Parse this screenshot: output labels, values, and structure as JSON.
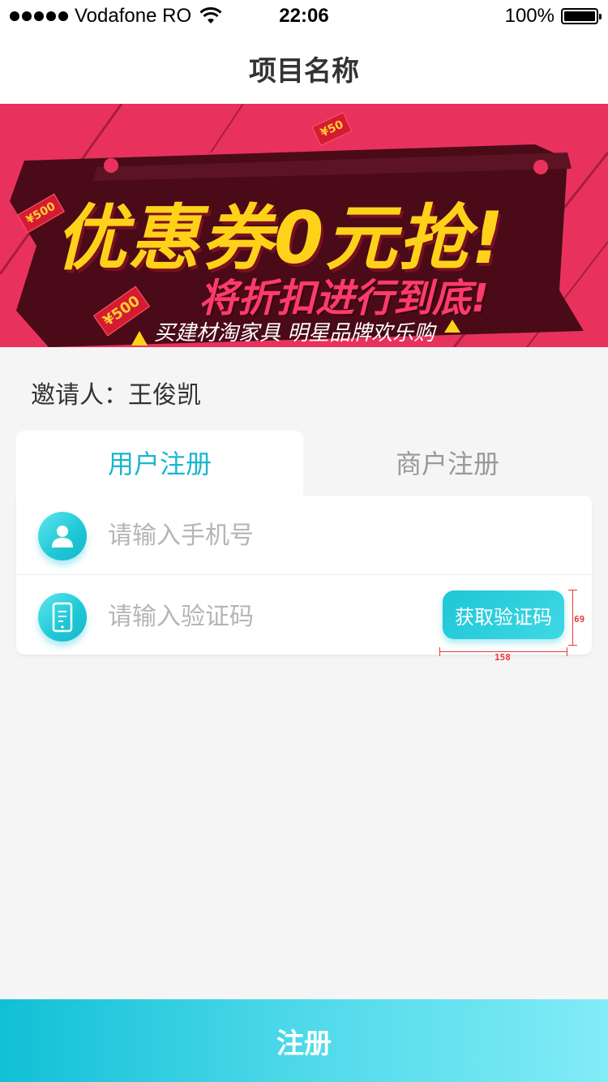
{
  "status_bar": {
    "carrier": "Vodafone RO",
    "time": "22:06",
    "battery": "100%",
    "battery_level": 1.0
  },
  "nav": {
    "title": "项目名称"
  },
  "banner": {
    "main_text": "优惠券0元抢!",
    "sub_text": "将折扣进行到底!",
    "tagline": "买建材淘家具 明星品牌欢乐购",
    "price_tags": [
      "¥500",
      "¥500",
      "¥50"
    ],
    "colors": {
      "background": "#e8325d",
      "board": "#4a0a18",
      "headline": "#ffd21a"
    }
  },
  "inviter": {
    "text": "邀请人：王俊凯"
  },
  "tabs": [
    {
      "label": "用户注册",
      "active": true
    },
    {
      "label": "商户注册",
      "active": false
    }
  ],
  "form": {
    "phone": {
      "placeholder": "请输入手机号",
      "value": "",
      "icon": "user-icon"
    },
    "code": {
      "placeholder": "请输入验证码",
      "value": "",
      "icon": "phone-icon"
    },
    "get_code_label": "获取验证码"
  },
  "annotations": {
    "width_label": "158",
    "height_label": "69"
  },
  "submit": {
    "label": "注册"
  },
  "colors": {
    "accent": "#1ab6d0",
    "tab_inactive": "#999999",
    "page_bg": "#f5f5f5"
  }
}
